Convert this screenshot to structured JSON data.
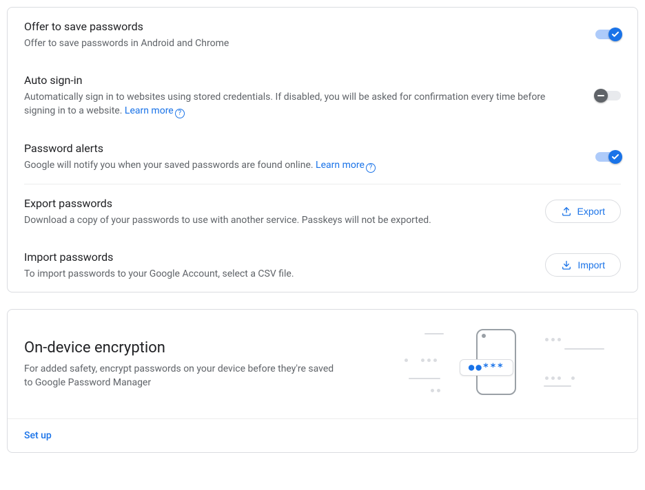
{
  "settings": {
    "offer": {
      "title": "Offer to save passwords",
      "desc": "Offer to save passwords in Android and Chrome",
      "on": true
    },
    "autosignin": {
      "title": "Auto sign-in",
      "desc_pre": "Automatically sign in to websites using stored credentials. If disabled, you will be asked for confirmation every time before signing in to a website. ",
      "learn": "Learn more",
      "on": false
    },
    "alerts": {
      "title": "Password alerts",
      "desc_pre": "Google will notify you when your saved passwords are found online. ",
      "learn": "Learn more",
      "on": true
    },
    "export": {
      "title": "Export passwords",
      "desc": "Download a copy of your passwords to use with another service. Passkeys will not be exported.",
      "button": "Export"
    },
    "import": {
      "title": "Import passwords",
      "desc": "To import passwords to your Google Account, select a CSV file.",
      "button": "Import"
    }
  },
  "ode": {
    "title": "On-device encryption",
    "desc": "For added safety, encrypt passwords on your device before they're saved to Google Password Manager",
    "setup": "Set up",
    "bubble": "●●***"
  }
}
